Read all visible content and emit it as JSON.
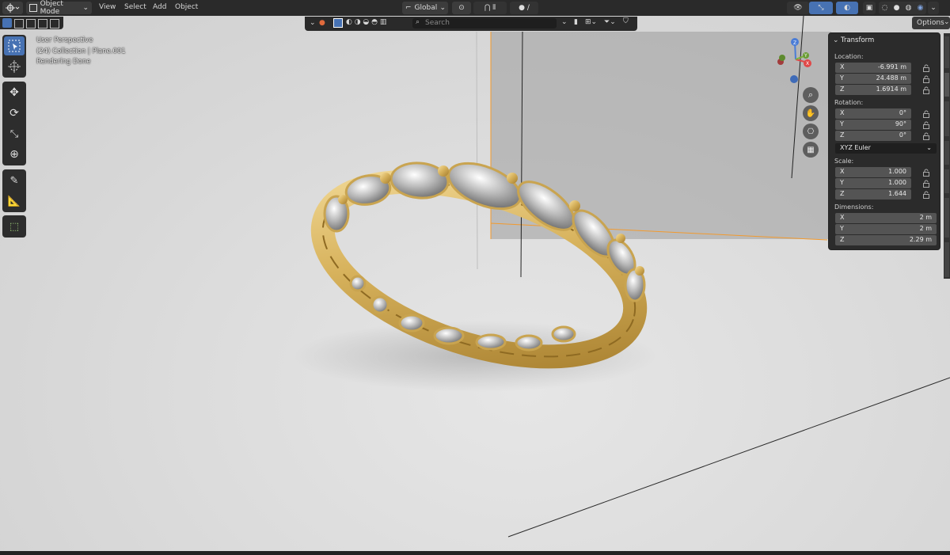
{
  "header": {
    "mode_label": "Object Mode",
    "menus": [
      "View",
      "Select",
      "Add",
      "Object"
    ],
    "orientation_label": "Global",
    "options_label": "Options"
  },
  "filter_bar": {
    "search_placeholder": "Search"
  },
  "overlay": {
    "line1": "User Perspective",
    "line2": "(24) Collection | Plane.001",
    "line3": "Rendering Done"
  },
  "transform": {
    "title": "Transform",
    "location_label": "Location:",
    "location": [
      {
        "axis": "X",
        "value": "-6.991 m"
      },
      {
        "axis": "Y",
        "value": "24.488 m"
      },
      {
        "axis": "Z",
        "value": "1.6914 m"
      }
    ],
    "rotation_label": "Rotation:",
    "rotation": [
      {
        "axis": "X",
        "value": "0°"
      },
      {
        "axis": "Y",
        "value": "90°"
      },
      {
        "axis": "Z",
        "value": "0°"
      }
    ],
    "rotation_mode": "XYZ Euler",
    "scale_label": "Scale:",
    "scale": [
      {
        "axis": "X",
        "value": "1.000"
      },
      {
        "axis": "Y",
        "value": "1.000"
      },
      {
        "axis": "Z",
        "value": "1.644"
      }
    ],
    "dimensions_label": "Dimensions:",
    "dimensions": [
      {
        "axis": "X",
        "value": "2 m"
      },
      {
        "axis": "Y",
        "value": "2 m"
      },
      {
        "axis": "Z",
        "value": "2.29 m"
      }
    ]
  },
  "gizmo": {
    "x": "X",
    "y": "Y",
    "z": "Z"
  },
  "colors": {
    "gold": "#e2c172",
    "accent_blue": "#4772b3",
    "selection_orange": "#f29a2e",
    "panel_bg": "#2b2b2b",
    "field_bg": "#545454"
  },
  "icons": {
    "tools": [
      "select-box-icon",
      "cursor-icon",
      "move-icon",
      "rotate-icon",
      "scale-icon",
      "transform-icon",
      "annotate-icon",
      "measure-icon",
      "add-cube-icon"
    ],
    "nav": [
      "zoom-icon",
      "hand-pan-icon",
      "camera-icon",
      "grid-perspective-icon"
    ]
  }
}
